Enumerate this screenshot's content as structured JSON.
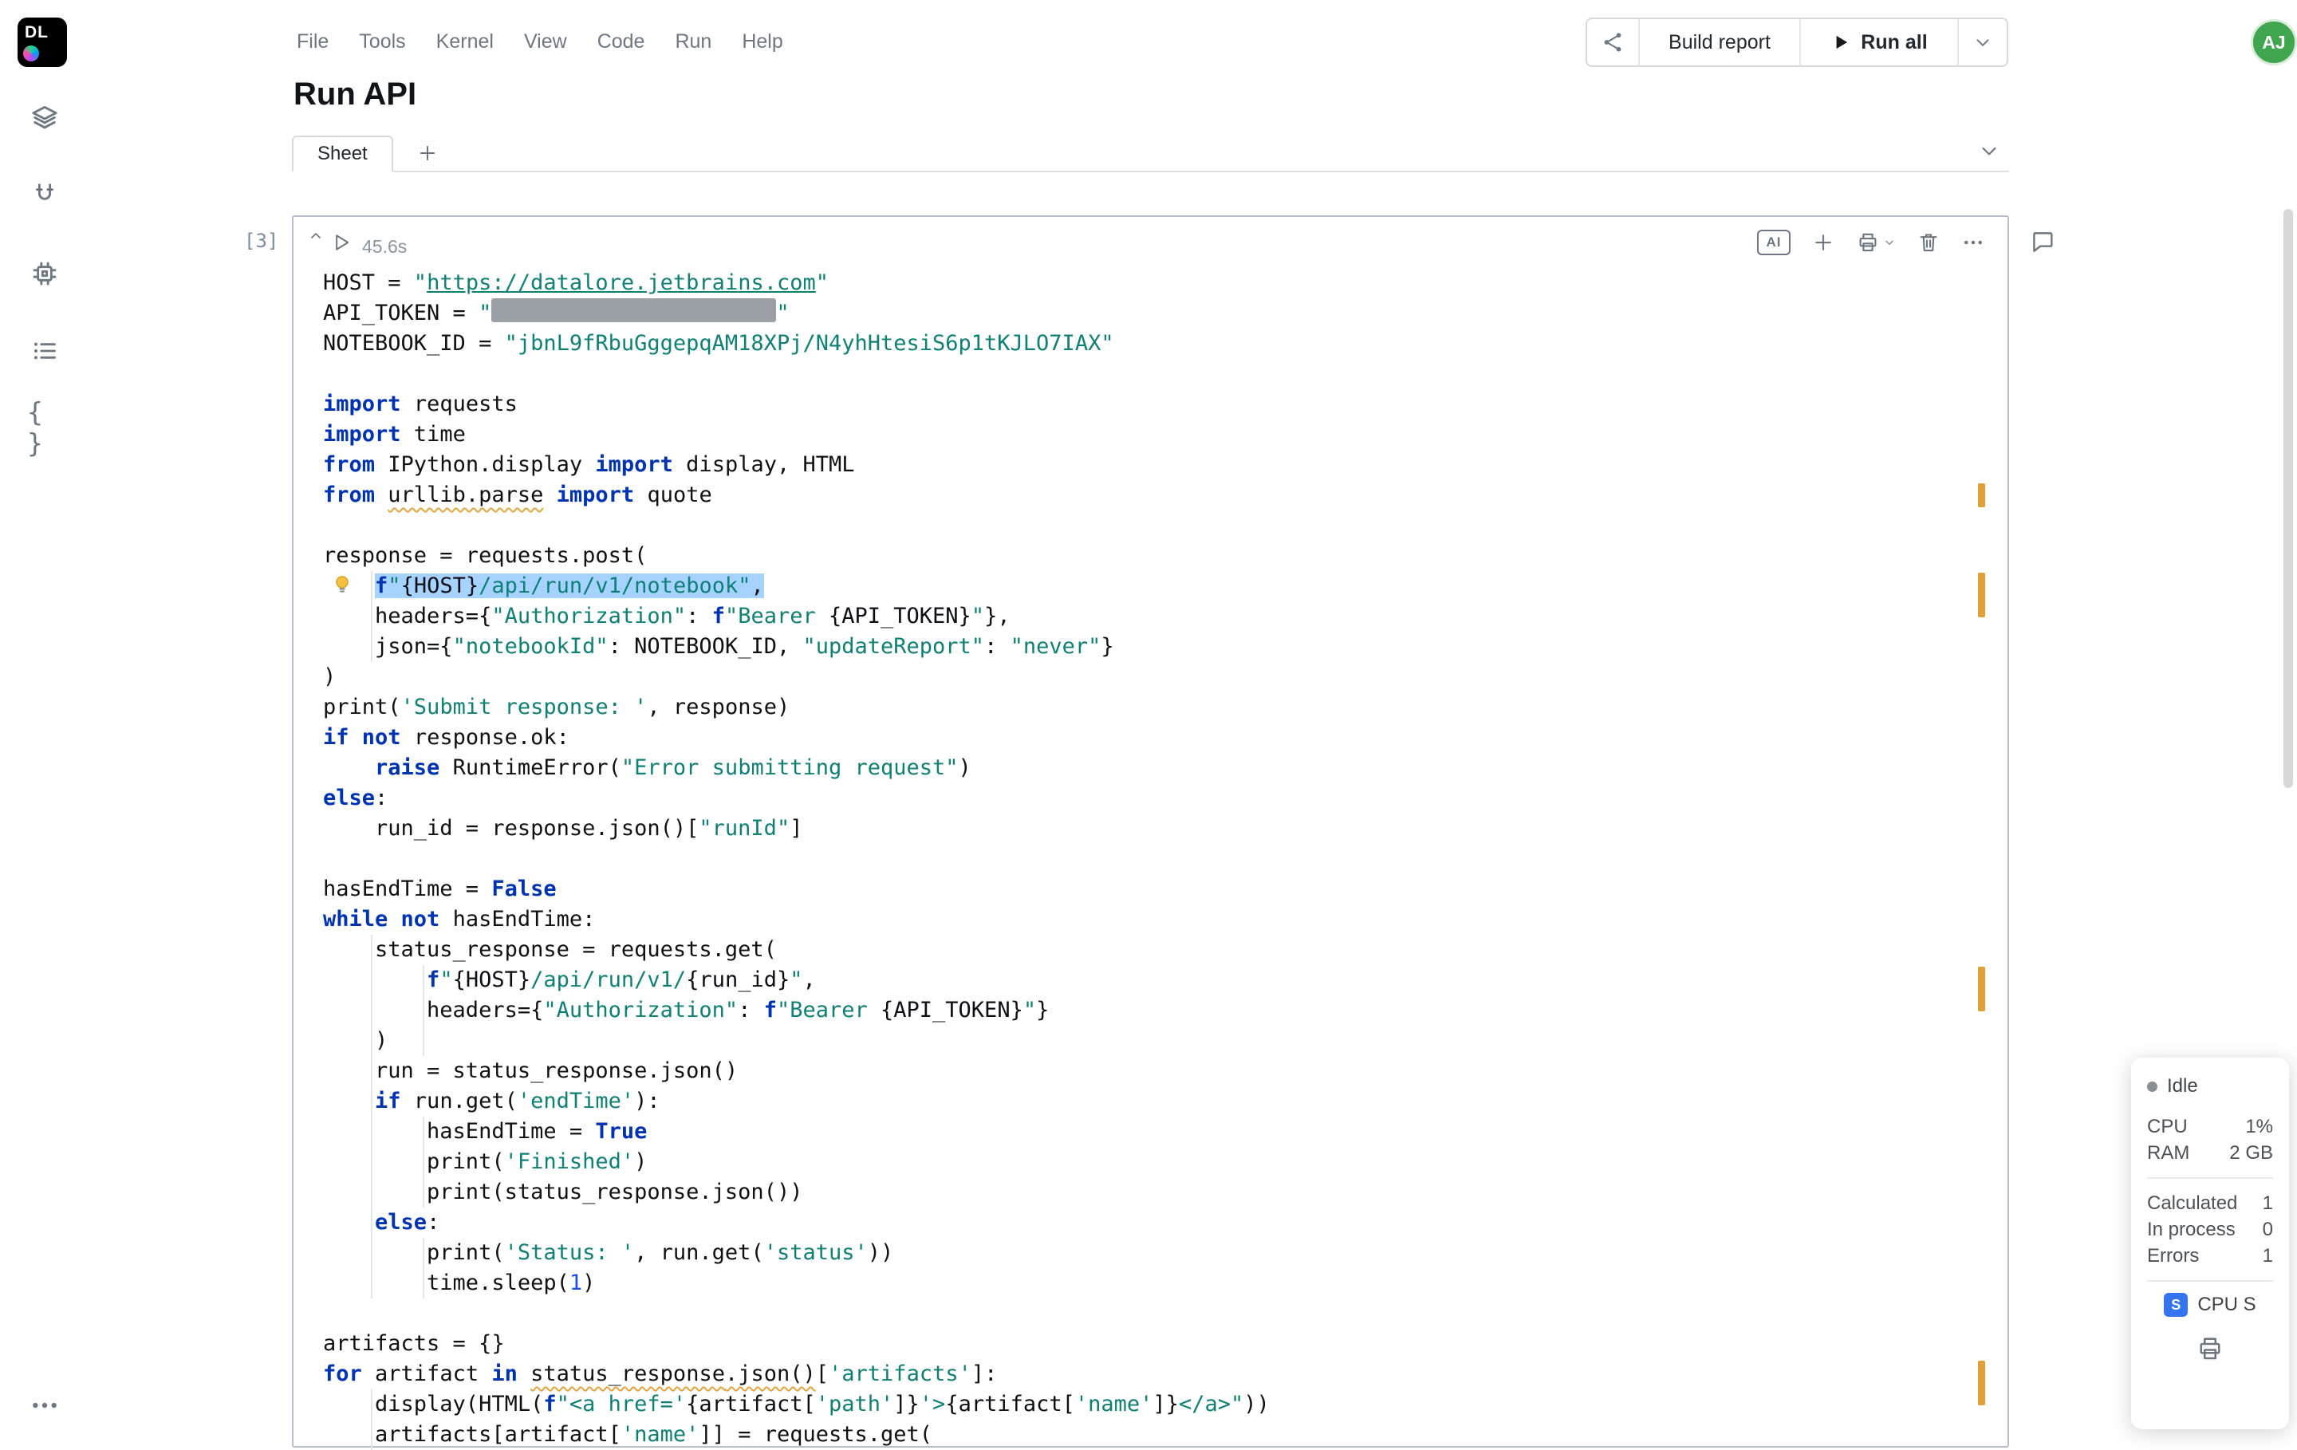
{
  "app": {
    "logo": "DL"
  },
  "menu": {
    "items": [
      "File",
      "Tools",
      "Kernel",
      "View",
      "Code",
      "Run",
      "Help"
    ]
  },
  "page": {
    "title": "Run API"
  },
  "tabs": {
    "active": "Sheet"
  },
  "toolbar": {
    "build_report": "Build report",
    "run_all": "Run all"
  },
  "user": {
    "initials": "AJ"
  },
  "icons": {
    "ai": "AI",
    "braces": "{ }"
  },
  "colors": {
    "selection": "#A6D2FF",
    "warning": "#E2A53E",
    "keyword": "#0033B3",
    "string": "#0E8174",
    "number": "#1750EB",
    "avatar": "#3FA54F",
    "machine_badge": "#3574F0",
    "marker": "#DFA03A"
  },
  "cell": {
    "execution_count": "[3]",
    "runtime": "45.6s",
    "code": {
      "lines": [
        [
          [
            "HOST = ",
            "p"
          ],
          [
            "\"",
            "s"
          ],
          [
            "https://datalore.jetbrains.com",
            "s l"
          ],
          [
            "\"",
            "s"
          ]
        ],
        [
          [
            "API_TOKEN = ",
            "p"
          ],
          [
            "\"",
            "s"
          ],
          [
            "",
            "s redact"
          ],
          [
            "\"",
            "s"
          ]
        ],
        [
          [
            "NOTEBOOK_ID = ",
            "p"
          ],
          [
            "\"jbnL9fRbuGggepqAM18XPj/N4yhHtesiS6p1tKJLO7IAX\"",
            "s"
          ]
        ],
        [],
        [
          [
            "import",
            "k"
          ],
          [
            " requests",
            "p"
          ]
        ],
        [
          [
            "import",
            "k"
          ],
          [
            " time",
            "p"
          ]
        ],
        [
          [
            "from",
            "k"
          ],
          [
            " IPython.display ",
            "p"
          ],
          [
            "import",
            "k"
          ],
          [
            " display, HTML",
            "p"
          ]
        ],
        [
          [
            "from",
            "k"
          ],
          [
            " ",
            "p"
          ],
          [
            "urllib.parse",
            "p w"
          ],
          [
            " ",
            "p"
          ],
          [
            "import",
            "k"
          ],
          [
            " quote",
            "p"
          ]
        ],
        [],
        [
          [
            "response = requests.post(",
            "p"
          ]
        ],
        [
          [
            "    ",
            "p"
          ],
          [
            "f",
            "k sel"
          ],
          [
            "\"",
            "s sel"
          ],
          [
            "{HOST}",
            "i sel"
          ],
          [
            "/api/run/v1/notebook",
            "s sel"
          ],
          [
            "\"",
            "s sel"
          ],
          [
            ",",
            "p sel"
          ]
        ],
        [
          [
            "    headers={",
            "p"
          ],
          [
            "\"Authorization\"",
            "s"
          ],
          [
            ": ",
            "p"
          ],
          [
            "f",
            "k"
          ],
          [
            "\"Bearer ",
            "s"
          ],
          [
            "{API_TOKEN}",
            "i"
          ],
          [
            "\"",
            "s"
          ],
          [
            "},",
            "p"
          ]
        ],
        [
          [
            "    json={",
            "p"
          ],
          [
            "\"notebookId\"",
            "s"
          ],
          [
            ": NOTEBOOK_ID, ",
            "p"
          ],
          [
            "\"updateReport\"",
            "s"
          ],
          [
            ": ",
            "p"
          ],
          [
            "\"never\"",
            "s"
          ],
          [
            "}",
            "p"
          ]
        ],
        [
          [
            ")",
            "p"
          ]
        ],
        [
          [
            "print(",
            "p"
          ],
          [
            "'Submit response: '",
            "s"
          ],
          [
            ", response)",
            "p"
          ]
        ],
        [
          [
            "if",
            "k"
          ],
          [
            " ",
            "p"
          ],
          [
            "not",
            "k"
          ],
          [
            " response.ok:",
            "p"
          ]
        ],
        [
          [
            "    ",
            "p"
          ],
          [
            "raise",
            "k"
          ],
          [
            " RuntimeError(",
            "p"
          ],
          [
            "\"Error submitting request\"",
            "s"
          ],
          [
            ")",
            "p"
          ]
        ],
        [
          [
            "else",
            "k"
          ],
          [
            ":",
            "p"
          ]
        ],
        [
          [
            "    run_id = response.json()[",
            "p"
          ],
          [
            "\"runId\"",
            "s"
          ],
          [
            "]",
            "p"
          ]
        ],
        [],
        [
          [
            "hasEndTime = ",
            "p"
          ],
          [
            "False",
            "k"
          ]
        ],
        [
          [
            "while",
            "k"
          ],
          [
            " ",
            "p"
          ],
          [
            "not",
            "k"
          ],
          [
            " hasEndTime:",
            "p"
          ]
        ],
        [
          [
            "    status_response = requests.get(",
            "p"
          ]
        ],
        [
          [
            "        ",
            "p"
          ],
          [
            "f",
            "k"
          ],
          [
            "\"",
            "s"
          ],
          [
            "{HOST}",
            "i"
          ],
          [
            "/api/run/v1/",
            "s"
          ],
          [
            "{run_id}",
            "i"
          ],
          [
            "\"",
            "s"
          ],
          [
            ",",
            "p"
          ]
        ],
        [
          [
            "        headers={",
            "p"
          ],
          [
            "\"Authorization\"",
            "s"
          ],
          [
            ": ",
            "p"
          ],
          [
            "f",
            "k"
          ],
          [
            "\"Bearer ",
            "s"
          ],
          [
            "{API_TOKEN}",
            "i"
          ],
          [
            "\"",
            "s"
          ],
          [
            "}",
            "p"
          ]
        ],
        [
          [
            "    )",
            "p"
          ]
        ],
        [
          [
            "    run = status_response.json()",
            "p"
          ]
        ],
        [
          [
            "    ",
            "p"
          ],
          [
            "if",
            "k"
          ],
          [
            " run.get(",
            "p"
          ],
          [
            "'endTime'",
            "s"
          ],
          [
            "):",
            "p"
          ]
        ],
        [
          [
            "        hasEndTime = ",
            "p"
          ],
          [
            "True",
            "k"
          ]
        ],
        [
          [
            "        print(",
            "p"
          ],
          [
            "'Finished'",
            "s"
          ],
          [
            ")",
            "p"
          ]
        ],
        [
          [
            "        print(status_response.json())",
            "p"
          ]
        ],
        [
          [
            "    ",
            "p"
          ],
          [
            "else",
            "k"
          ],
          [
            ":",
            "p"
          ]
        ],
        [
          [
            "        print(",
            "p"
          ],
          [
            "'Status: '",
            "s"
          ],
          [
            ", run.get(",
            "p"
          ],
          [
            "'status'",
            "s"
          ],
          [
            "))",
            "p"
          ]
        ],
        [
          [
            "        time.sleep(",
            "p"
          ],
          [
            "1",
            "n"
          ],
          [
            ")",
            "p"
          ]
        ],
        [],
        [
          [
            "artifacts = {}",
            "p"
          ]
        ],
        [
          [
            "for",
            "k"
          ],
          [
            " artifact ",
            "p"
          ],
          [
            "in",
            "k"
          ],
          [
            " ",
            "p"
          ],
          [
            "status_response",
            "p w"
          ],
          [
            ".json()",
            "p w"
          ],
          [
            "[",
            "p"
          ],
          [
            "'artifacts'",
            "s"
          ],
          [
            "]:",
            "p"
          ]
        ],
        [
          [
            "    display(HTML(",
            "p"
          ],
          [
            "f",
            "k"
          ],
          [
            "\"<a href='",
            "s"
          ],
          [
            "{artifact[",
            "i"
          ],
          [
            "'path'",
            "s"
          ],
          [
            "]}",
            "i"
          ],
          [
            "'>",
            "s"
          ],
          [
            "{artifact[",
            "i"
          ],
          [
            "'name'",
            "s"
          ],
          [
            "]}",
            "i"
          ],
          [
            "</a>\"",
            "s"
          ],
          [
            "))",
            "p"
          ]
        ],
        [
          [
            "    artifacts[artifact[",
            "p"
          ],
          [
            "'name'",
            "s"
          ],
          [
            "]] = requests.get(",
            "p"
          ]
        ]
      ]
    }
  },
  "status_panel": {
    "state": "Idle",
    "metrics": [
      {
        "label": "CPU",
        "value": "1%"
      },
      {
        "label": "RAM",
        "value": "2 GB"
      }
    ],
    "counters": [
      {
        "label": "Calculated",
        "value": "1"
      },
      {
        "label": "In process",
        "value": "0"
      },
      {
        "label": "Errors",
        "value": "1"
      }
    ],
    "machine": {
      "badge": "S",
      "label": "CPU S"
    }
  }
}
